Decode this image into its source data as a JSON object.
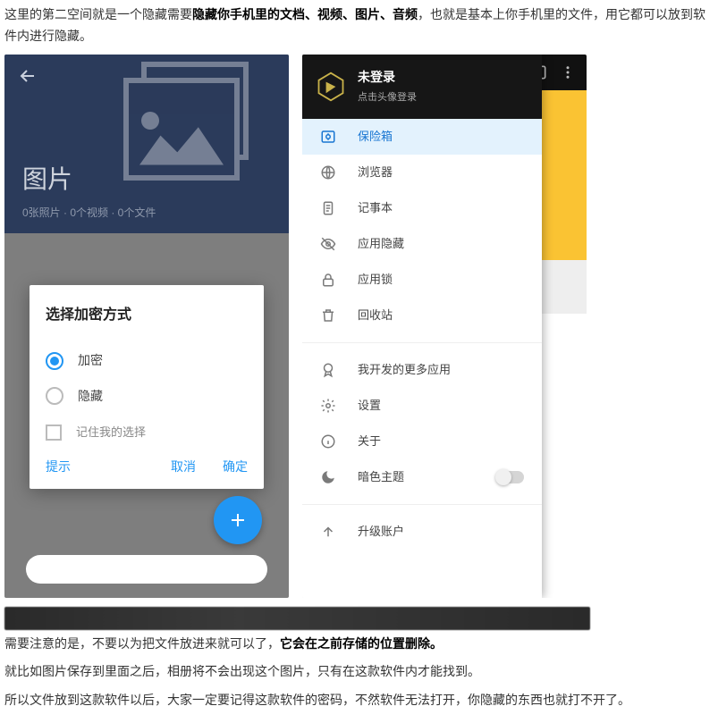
{
  "article": {
    "intro_pre": "这里的第二空间就是一个隐藏需要",
    "intro_bold": "隐藏你手机里的文档、视频、图片、音频",
    "intro_post": "，也就是基本上你手机里的文件，用它都可以放到软件内进行隐藏。",
    "outro1_pre": "需要注意的是，不要以为把文件放进来就可以了，",
    "outro1_bold": "它会在之前存储的位置删除。",
    "outro2": "就比如图片保存到里面之后，相册将不会出现这个图片，只有在这款软件内才能找到。",
    "outro3": "所以文件放到这款软件以后，大家一定要记得这款软件的密码，不然软件无法打开，你隐藏的东西也就打不开了。"
  },
  "phone1": {
    "title": "图片",
    "subtitle": "0张照片 · 0个视频 · 0个文件",
    "dialog": {
      "header": "选择加密方式",
      "optEncrypt": "加密",
      "optHide": "隐藏",
      "remember": "记住我的选择",
      "hint": "提示",
      "cancel": "取消",
      "ok": "确定"
    }
  },
  "phone2": {
    "header": {
      "line1": "未登录",
      "line2": "点击头像登录"
    },
    "items": {
      "vault": "保险箱",
      "browser": "浏览器",
      "notes": "记事本",
      "appHide": "应用隐藏",
      "appLock": "应用锁",
      "recycle": "回收站",
      "moreApps": "我开发的更多应用",
      "settings": "设置",
      "about": "关于",
      "darkTheme": "暗色主题",
      "upgrade": "升级账户"
    }
  }
}
